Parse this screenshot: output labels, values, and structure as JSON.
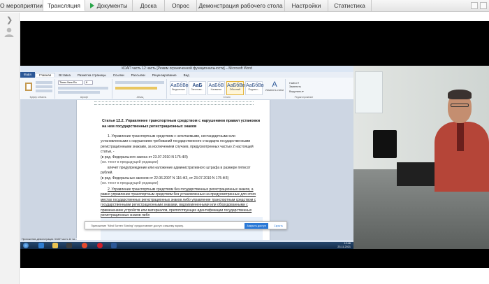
{
  "tabs": [
    {
      "label": "О мероприятии"
    },
    {
      "label": "Трансляция",
      "active": true
    },
    {
      "label": "Документы",
      "icon": "play-icon"
    },
    {
      "label": "Доска"
    },
    {
      "label": "Опрос"
    },
    {
      "label": "Демонстрация рабочего стола"
    },
    {
      "label": "Настройки"
    },
    {
      "label": "Статистика"
    }
  ],
  "colors": {
    "accent": "#2aa54a",
    "video_bg": "#000000",
    "word_blue": "#2b5797"
  },
  "word": {
    "title": "КОАП часть 12 часть [Режим ограниченной функциональности] – Microsoft Word",
    "file_tab": "Файл",
    "menu": [
      "Главная",
      "Вставка",
      "Разметка страницы",
      "Ссылки",
      "Рассылки",
      "Рецензирование",
      "Вид"
    ],
    "ribbon_groups": [
      "Буфер обмена",
      "Шрифт",
      "Абзац",
      "Стили",
      "Редактирование"
    ],
    "font_name": "Times New Ro",
    "font_size": "8",
    "styles": [
      {
        "sample": "АаБбВвГ",
        "name": "Выделение"
      },
      {
        "sample": "АаБ",
        "name": "Заголово..."
      },
      {
        "sample": "АаБбВ",
        "name": "Название"
      },
      {
        "sample": "АаБбВв",
        "name": "Обычный"
      },
      {
        "sample": "АаБбВв",
        "name": "Подзаго..."
      }
    ],
    "change_styles": "Изменить стили",
    "editing": [
      "Найти ▾",
      "Заменить",
      "Выделить ▾"
    ],
    "heading": "Статья 12.2. Управление транспортным средством с нарушением правил установки на нем государственных регистрационных знаков",
    "paragraphs": [
      "1. Управление транспортным средством с нечитаемыми, нестандартными или установленными с нарушением требований государственного стандарта государственными регистрационными знаками, за исключением случаев, предусмотренных частью 2 настоящей статьи, -",
      "(в ред. Федерального закона от 23.07.2010 N 175-ФЗ)",
      "(см. текст в предыдущей редакции)",
      "влечет предупреждение или наложение административного штрафа в размере пятисот рублей.",
      "(в ред. Федеральных законов от 22.06.2007 N 116-ФЗ, от 23.07.2010 N 175-ФЗ)",
      "(см. текст в предыдущей редакции)",
      "2. Управление транспортным средством без государственных регистрационных знаков, а равно управление транспортным средством без установленных на предусмотренных для этого местах государственных регистрационных знаков либо управление транспортным средством с государственными регистрационными знаками, видоизмененными или оборудованными с применением устройств или материалов, препятствующих идентификации государственных регистрационных знаков либо"
    ],
    "share_text": "Приложение \"Mind Screen Sharing\" предоставляет доступ к вашему экрану.",
    "share_button": "Закрыть доступ",
    "share_hide": "Скрыть",
    "taskbar_status": "Приложение-демонстрация: КОАП часть 12 ча...",
    "clock_time": "12:46",
    "clock_date": "23.11.2021"
  }
}
